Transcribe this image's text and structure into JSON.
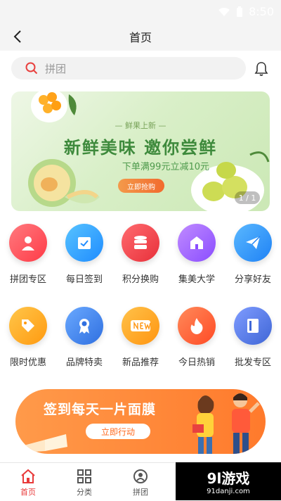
{
  "status": {
    "time": "8:50"
  },
  "nav": {
    "title": "首页"
  },
  "search": {
    "placeholder": "拼团"
  },
  "banner": {
    "tag": "— 鲜果上新 —",
    "headline": "新鲜美味 邀你尝鲜",
    "subline": "下单满99元立减10元",
    "button": "立即抢购",
    "pager": "1 / 1"
  },
  "grid": [
    {
      "label": "拼团专区",
      "color": "#ff4b55",
      "icon": "user-icon"
    },
    {
      "label": "每日签到",
      "color": "#2aa2ff",
      "icon": "calendar-check-icon"
    },
    {
      "label": "积分换购",
      "color": "#ff3b47",
      "icon": "database-icon"
    },
    {
      "label": "集美大学",
      "color": "#9b59ff",
      "icon": "building-icon"
    },
    {
      "label": "分享好友",
      "color": "#2c9cff",
      "icon": "paper-plane-icon"
    },
    {
      "label": "限时优惠",
      "color": "#ffaa1f",
      "icon": "tag-icon"
    },
    {
      "label": "品牌特卖",
      "color": "#3d88f5",
      "icon": "award-icon"
    },
    {
      "label": "新品推荐",
      "color": "#ffa51a",
      "icon": "new-badge-icon"
    },
    {
      "label": "今日热销",
      "color": "#ff5a36",
      "icon": "flame-icon"
    },
    {
      "label": "批发专区",
      "color": "#4c79e0",
      "icon": "book-icon"
    }
  ],
  "promo": {
    "title": "签到每天一片面膜",
    "button": "立即行动"
  },
  "tabs": [
    {
      "label": "首页",
      "icon": "home-icon"
    },
    {
      "label": "分类",
      "icon": "grid-icon"
    },
    {
      "label": "拼团",
      "icon": "group-icon"
    }
  ],
  "watermark": {
    "line1": "9l游戏",
    "line2": "91danji.com"
  }
}
